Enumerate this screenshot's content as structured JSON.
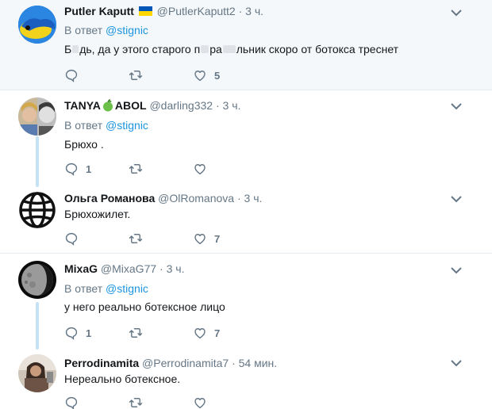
{
  "tweets": [
    {
      "name": "Putler Kaputt",
      "handle": "@PutlerKaputt2",
      "dot": "·",
      "time": "3 ч.",
      "reply_prefix": "В ответ",
      "reply_mention": "@stignic",
      "text_parts": [
        "Б",
        "дь, да у этого старого п",
        "ра",
        "льник скоро от ботокса треснет"
      ],
      "reply_count": "",
      "like_count": "5",
      "flag_colors": [
        "#0057b7",
        "#ffd700"
      ]
    },
    {
      "name_a": "TANYA",
      "name_b": "ABOL",
      "handle": "@darling332",
      "dot": "·",
      "time": "3 ч.",
      "reply_prefix": "В ответ",
      "reply_mention": "@stignic",
      "text": "Брюхо .",
      "reply_count": "1",
      "like_count": ""
    },
    {
      "name": "Ольга Романова",
      "handle": "@OlRomanova",
      "dot": "·",
      "time": "3 ч.",
      "text": "Брюхожилет.",
      "reply_count": "",
      "like_count": "7"
    },
    {
      "name": "MixaG",
      "handle": "@MixaG77",
      "dot": "·",
      "time": "3 ч.",
      "reply_prefix": "В ответ",
      "reply_mention": "@stignic",
      "text": "у него реально ботексное лицо",
      "reply_count": "1",
      "like_count": "7"
    },
    {
      "name": "Perrodinamita",
      "handle": "@Perrodinamita7",
      "dot": "·",
      "time": "54 мин.",
      "text": "Нереально ботексное.",
      "reply_count": "",
      "like_count": ""
    }
  ],
  "icons": [
    "reply-icon",
    "retweet-icon",
    "like-icon",
    "chevron-down-icon",
    "globe-icon",
    "apple-icon",
    "flag-icon"
  ],
  "colors": {
    "accent": "#1b95e0",
    "muted": "#657786",
    "thread": "#c4e2f5",
    "highlight_bg": "#f5f8fa"
  }
}
